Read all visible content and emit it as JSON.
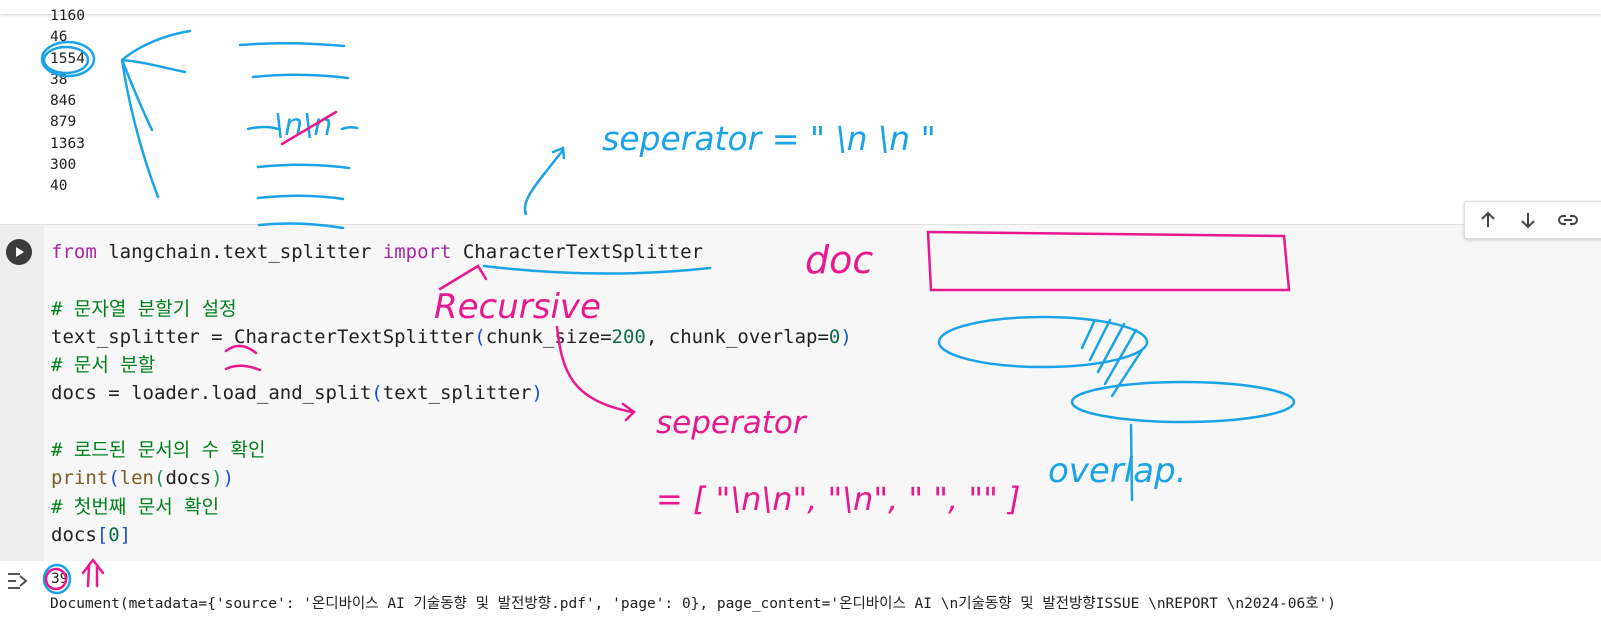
{
  "previous_output": {
    "lines": [
      "1160",
      "46",
      "1554",
      "38",
      "846",
      "879",
      "1363",
      "300",
      "40"
    ]
  },
  "cell_toolbar": {
    "move_up_icon": "arrow-up-icon",
    "move_down_icon": "arrow-down-icon",
    "link_icon": "link-icon"
  },
  "code_cell": {
    "run_icon": "play-icon",
    "line1": {
      "kw1": "from",
      "mod": " langchain.text_splitter ",
      "kw2": "import",
      "cls": " CharacterTextSplitter"
    },
    "line3": "# 문자열 분할기 설정",
    "line4": {
      "a": "text_splitter = CharacterTextSplitter",
      "p1": "(",
      "b": "chunk_size=",
      "n1": "200",
      "c": ", chunk_overlap=",
      "n2": "0",
      "p2": ")"
    },
    "line5": "# 문서 분할",
    "line6": {
      "a": "docs = loader.load_and_split",
      "p1": "(",
      "b": "text_splitter",
      "p2": ")"
    },
    "line8": "# 로드된 문서의 수 확인",
    "line9": {
      "f": "print",
      "p1": "(",
      "g": "len",
      "p2": "(",
      "a": "docs",
      "p3": ")",
      "p4": ")"
    },
    "line10": "# 첫번째 문서 확인",
    "line11": {
      "a": "docs",
      "p1": "[",
      "n": "0",
      "p2": "]"
    }
  },
  "output": {
    "icon": "output-toggle-icon",
    "count": "39",
    "document": "Document(metadata={'source': '온디바이스 AI 기술동향 및 발전방향.pdf', 'page': 0}, page_content='온디바이스 AI \\n기술동향 및 발전방향ISSUE \\nREPORT \\n2024-06호')"
  },
  "annotations": {
    "blue_color": "#1aa3e6",
    "pink_color": "#e8188f",
    "sep_label": "seperator = \" \\n \\n \"",
    "doc_label": "doc",
    "recursive_label": "Recursive",
    "sep2_label": "seperator",
    "sep_list": "= [ \"\\n\\n\", \"\\n\", \"  \", \"\" ]",
    "newline_label": "\\n\\n",
    "overlap_label": "overlap."
  }
}
